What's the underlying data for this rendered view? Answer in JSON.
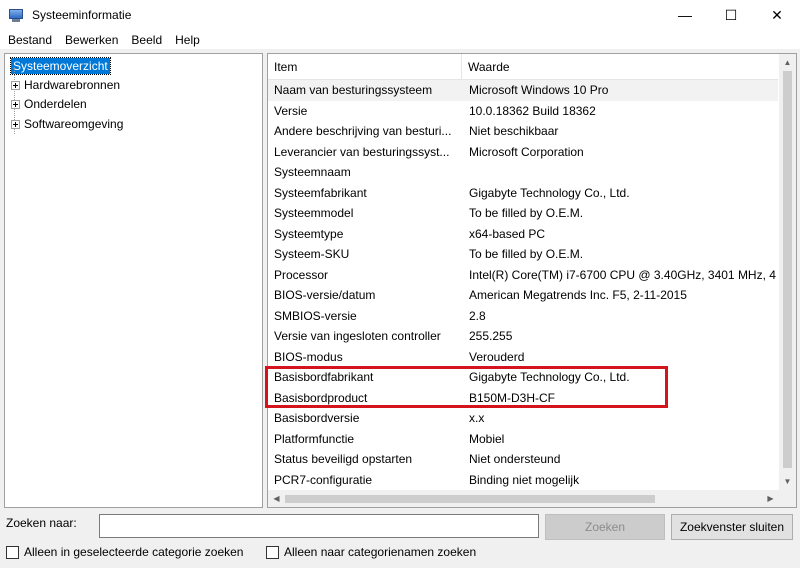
{
  "window": {
    "title": "Systeeminformatie",
    "controls": {
      "minimize": "—",
      "maximize": "☐",
      "close": "✕"
    }
  },
  "menu": [
    "Bestand",
    "Bewerken",
    "Beeld",
    "Help"
  ],
  "tree": {
    "root": "Systeemoverzicht",
    "children": [
      "Hardwarebronnen",
      "Onderdelen",
      "Softwareomgeving"
    ]
  },
  "list": {
    "columns": [
      "Item",
      "Waarde"
    ],
    "rows": [
      [
        "Naam van besturingssysteem",
        "Microsoft Windows 10 Pro"
      ],
      [
        "Versie",
        "10.0.18362 Build 18362"
      ],
      [
        "Andere beschrijving van besturi...",
        "Niet beschikbaar"
      ],
      [
        "Leverancier van besturingssyst...",
        "Microsoft Corporation"
      ],
      [
        "Systeemnaam",
        ""
      ],
      [
        "Systeemfabrikant",
        "Gigabyte Technology Co., Ltd."
      ],
      [
        "Systeemmodel",
        "To be filled by O.E.M."
      ],
      [
        "Systeemtype",
        "x64-based PC"
      ],
      [
        "Systeem-SKU",
        "To be filled by O.E.M."
      ],
      [
        "Processor",
        "Intel(R) Core(TM) i7-6700 CPU @ 3.40GHz, 3401 MHz, 4"
      ],
      [
        "BIOS-versie/datum",
        "American Megatrends Inc. F5, 2-11-2015"
      ],
      [
        "SMBIOS-versie",
        "2.8"
      ],
      [
        "Versie van ingesloten controller",
        "255.255"
      ],
      [
        "BIOS-modus",
        "Verouderd"
      ],
      [
        "Basisbordfabrikant",
        "Gigabyte Technology Co., Ltd."
      ],
      [
        "Basisbordproduct",
        "B150M-D3H-CF"
      ],
      [
        "Basisbordversie",
        "x.x"
      ],
      [
        "Platformfunctie",
        "Mobiel"
      ],
      [
        "Status beveiligd opstarten",
        "Niet ondersteund"
      ],
      [
        "PCR7-configuratie",
        "Binding niet mogelijk"
      ]
    ]
  },
  "search": {
    "label": "Zoeken naar:",
    "value": "",
    "search_button": "Zoeken",
    "close_button": "Zoekvenster sluiten",
    "option_selected_category": "Alleen in geselecteerde categorie zoeken",
    "option_category_names": "Alleen naar categorienamen zoeken"
  },
  "colors": {
    "highlight_box": "#d4141d",
    "selection": "#0078d7"
  }
}
